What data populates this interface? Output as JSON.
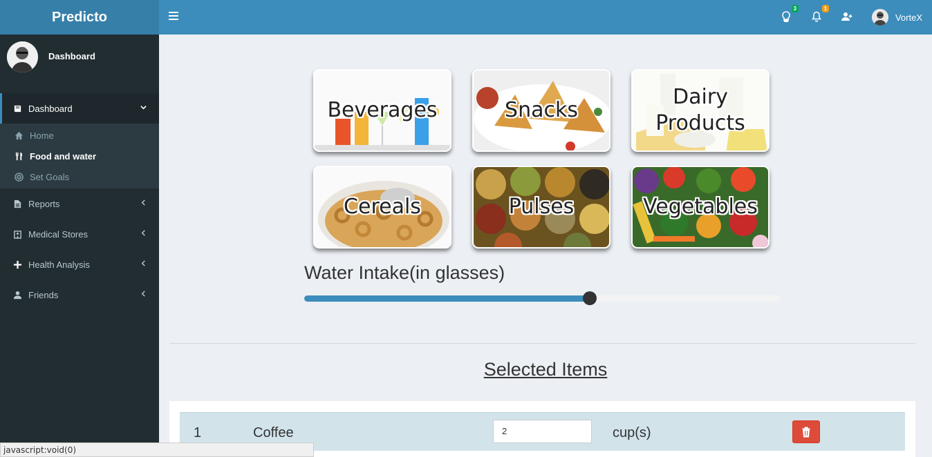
{
  "app": {
    "title": "Predicto"
  },
  "header": {
    "tips_badge": "3",
    "notifications_badge": "1",
    "user_name": "VorteX"
  },
  "sidebar": {
    "user_panel_name": "Dashboard",
    "items": [
      {
        "label": "Dashboard",
        "icon": "book-icon",
        "active": true
      },
      {
        "label": "Reports",
        "icon": "file-icon"
      },
      {
        "label": "Medical Stores",
        "icon": "hospital-icon"
      },
      {
        "label": "Health Analysis",
        "icon": "plus-icon"
      },
      {
        "label": "Friends",
        "icon": "user-icon"
      }
    ],
    "sub_items": [
      {
        "label": "Home",
        "icon": "home-icon"
      },
      {
        "label": "Food and water",
        "icon": "cutlery-icon",
        "current": true
      },
      {
        "label": "Set Goals",
        "icon": "bullseye-icon"
      }
    ]
  },
  "categories": [
    {
      "label": "Beverages"
    },
    {
      "label": "Snacks"
    },
    {
      "label": "Dairy Products"
    },
    {
      "label": "Cereals"
    },
    {
      "label": "Pulses"
    },
    {
      "label": "Vegetables"
    }
  ],
  "water": {
    "title": "Water Intake(in glasses)",
    "level_fraction": 0.6
  },
  "selected": {
    "title": "Selected Items",
    "rows": [
      {
        "index": "1",
        "item": "Coffee",
        "quantity": "2",
        "unit": "cup(s)"
      }
    ]
  },
  "status_bar": {
    "text": "javascript:void(0)"
  },
  "colors": {
    "header": "#3c8dbc",
    "logo": "#367fa9",
    "sidebar": "#222d32",
    "danger": "#dd4b39"
  }
}
